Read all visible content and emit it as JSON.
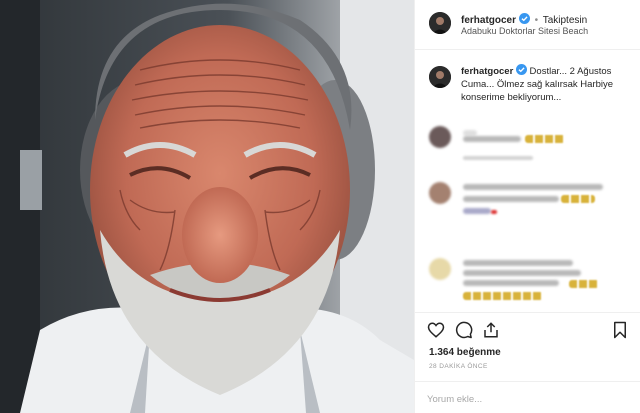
{
  "post": {
    "username": "ferhatgocer",
    "follow_label": "Takiptesin",
    "separator": "•",
    "location": "Adabuku Doktorlar Sitesi Beach",
    "caption_username": "ferhatgocer",
    "caption_text": "Dostlar... 2 Ağustos Cuma... Ölmez sağ kalırsak Harbiye konserime bekliyorum...",
    "likes": "1.364 beğenme",
    "time_ago": "28 DAKİKA ÖNCE",
    "comment_placeholder": "Yorum ekle..."
  },
  "icons": {
    "like": "heart-icon",
    "comment": "comment-icon",
    "share": "share-icon",
    "save": "bookmark-icon",
    "verified": "verified-badge-icon"
  },
  "colors": {
    "verified_blue": "#3897f0",
    "border": "#efefef",
    "muted_text": "#8e8e8e"
  }
}
